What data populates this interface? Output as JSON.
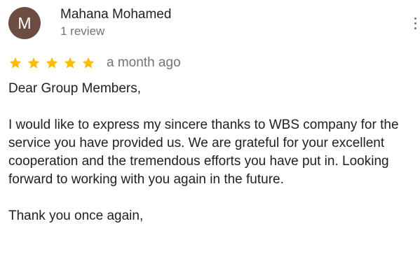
{
  "review": {
    "avatar_initial": "M",
    "reviewer_name": "Mahana Mohamed",
    "reviewer_meta": "1 review",
    "rating": 5,
    "rating_max": 5,
    "date": "a month ago",
    "body": {
      "greeting": "Dear Group Members,",
      "paragraph": "I would like to express my sincere thanks to WBS company for the service you have provided us. We are grateful for your excellent cooperation and the tremendous efforts you have put in. Looking forward to working with you again in the future.",
      "closing": "Thank you once again,"
    }
  },
  "icons": {
    "more": "more-vert-icon",
    "star": "star-icon"
  },
  "colors": {
    "avatar_bg": "#6d4c41",
    "star": "#fbbc04",
    "secondary_text": "#70757a",
    "primary_text": "#202124"
  }
}
